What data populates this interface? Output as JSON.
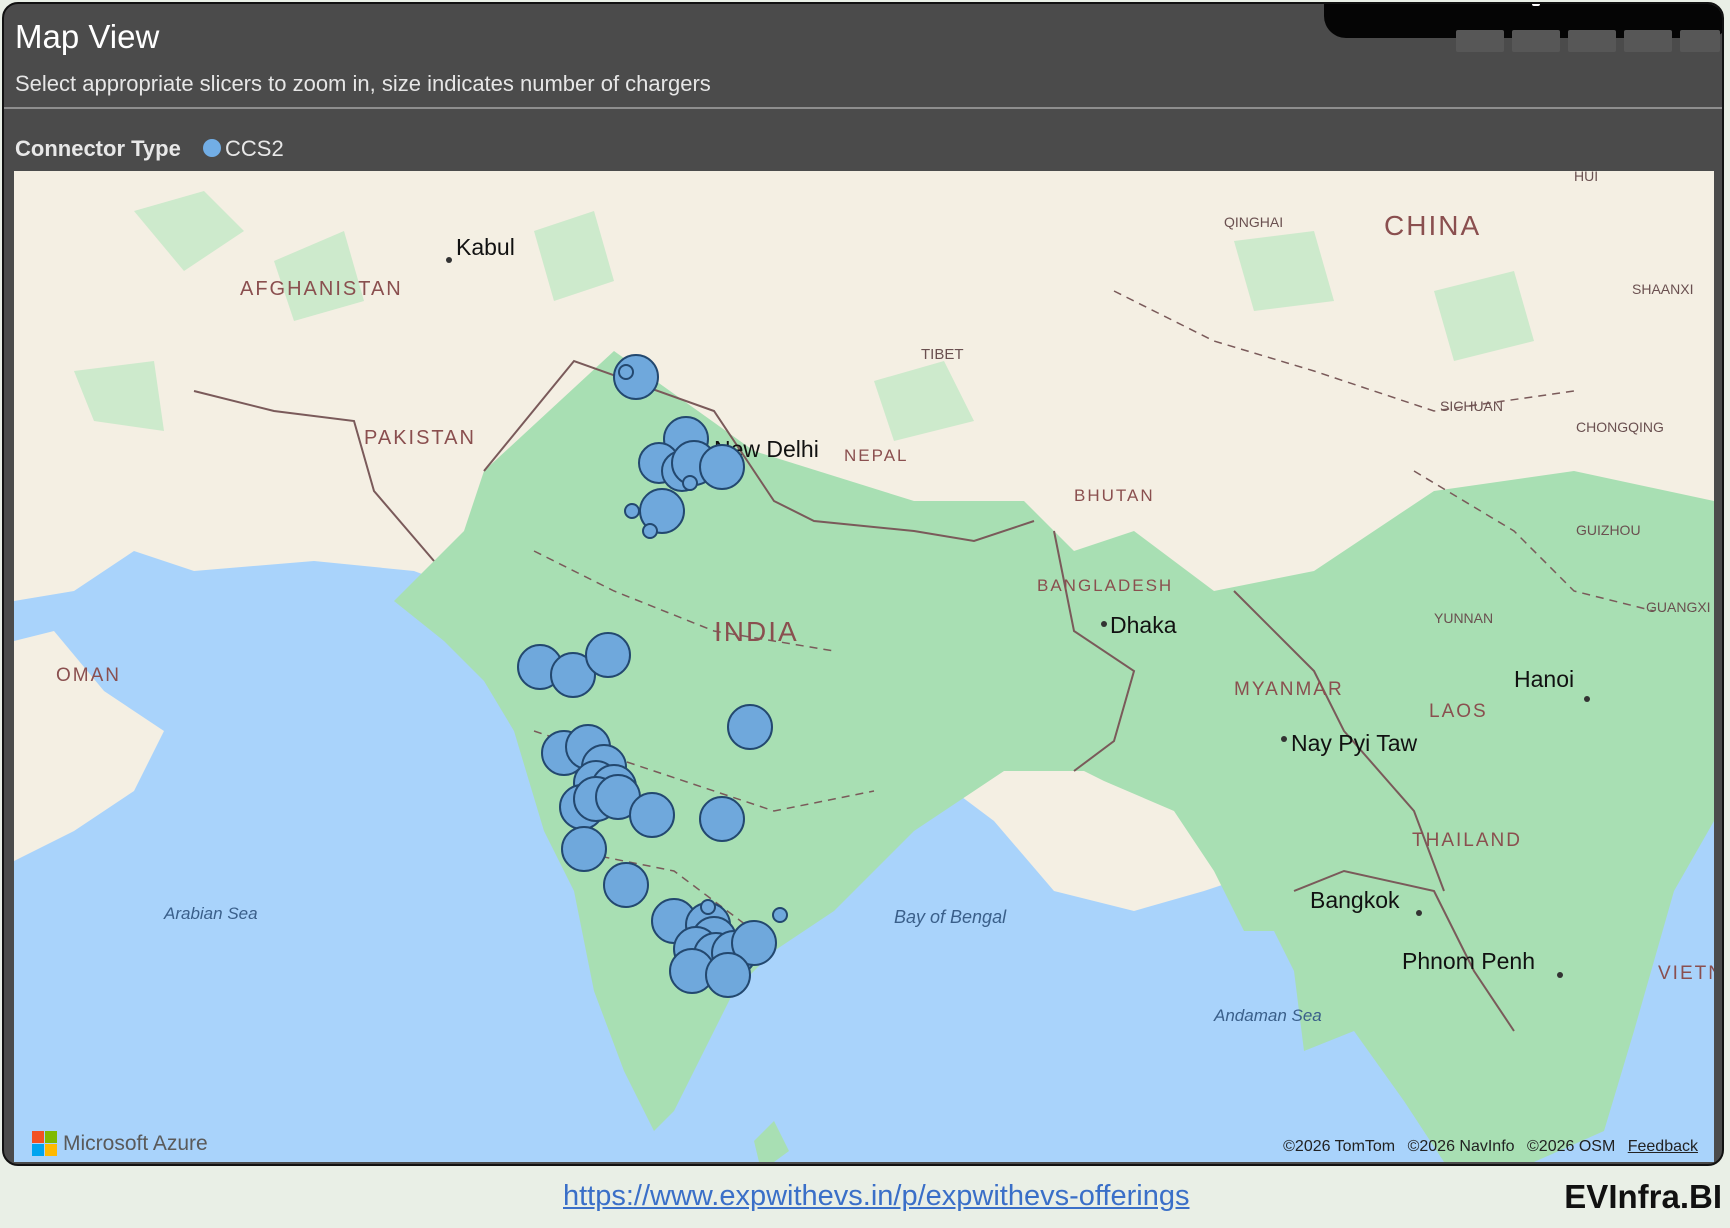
{
  "header": {
    "title": "Map View",
    "subtitle": "Select appropriate slicers to zoom in, size indicates number of chargers"
  },
  "legend": {
    "title": "Connector Type",
    "items": [
      {
        "label": "CCS2",
        "color": "#72aee6"
      }
    ]
  },
  "map": {
    "country_labels": [
      {
        "text": "CHINA",
        "icon": "country-label"
      },
      {
        "text": "AFGHANISTAN",
        "icon": "country-label"
      },
      {
        "text": "PAKISTAN",
        "icon": "country-label"
      },
      {
        "text": "INDIA",
        "icon": "country-label"
      },
      {
        "text": "NEPAL",
        "icon": "country-label"
      },
      {
        "text": "BHUTAN",
        "icon": "country-label"
      },
      {
        "text": "BANGLADESH",
        "icon": "country-label"
      },
      {
        "text": "MYANMAR",
        "icon": "country-label"
      },
      {
        "text": "LAOS",
        "icon": "country-label"
      },
      {
        "text": "THAILAND",
        "icon": "country-label"
      },
      {
        "text": "OMAN",
        "icon": "country-label"
      },
      {
        "text": "VIETNA",
        "icon": "country-label"
      }
    ],
    "region_labels": [
      "QINGHAI",
      "TIBET",
      "SICHUAN",
      "CHONGQING",
      "GUIZHOU",
      "YUNNAN",
      "GUANGXI ZHUANG",
      "SHAANXI",
      "HUI"
    ],
    "city_labels": [
      "Kabul",
      "New Delhi",
      "Dhaka",
      "Hanoi",
      "Nay Pyi Taw",
      "Bangkok",
      "Phnom Penh"
    ],
    "sea_labels": [
      "Arabian Sea",
      "Bay of Bengal",
      "Andaman Sea"
    ],
    "attribution": [
      "©2026 TomTom",
      "©2026 NavInfo",
      "©2026 OSM",
      "Feedback"
    ],
    "provider": "Microsoft Azure"
  },
  "footer": {
    "link": "https://www.expwithevs.in/p/expwithevs-offerings",
    "brand": "EVInfra.BI"
  }
}
